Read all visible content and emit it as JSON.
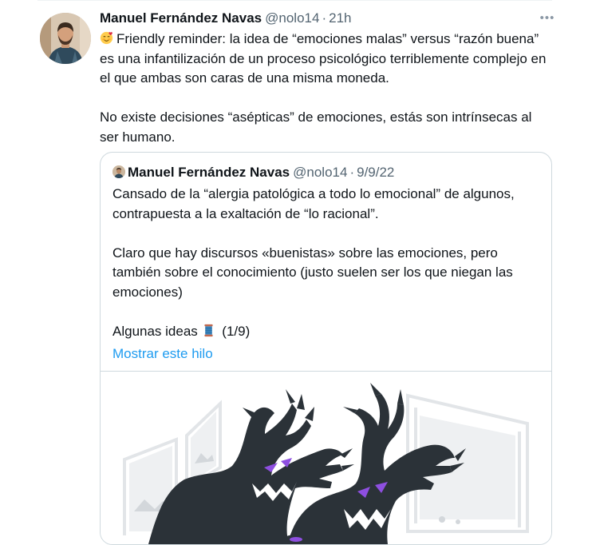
{
  "tweet": {
    "author_name": "Manuel Fernández Navas",
    "handle": "@nolo14",
    "separator": "·",
    "time": "21h",
    "emoji": "smiling-face-with-hearts",
    "paragraphs": [
      "Friendly reminder: la idea de “emociones malas” versus “razón buena” es una infantilización de un proceso psicológico terriblemente complejo en el que ambas son caras de una misma moneda.",
      "No existe decisiones “asépticas” de emociones, estás son intrínsecas al ser humano."
    ],
    "more_icon": "more-horizontal-icon"
  },
  "quoted_tweet": {
    "author_name": "Manuel Fernández Navas",
    "handle": "@nolo14",
    "separator": "·",
    "date": "9/9/22",
    "paragraphs": [
      "Cansado de la “alergia patológica a todo lo emocional” de algunos, contrapuesta a la exaltación de “lo racional”.",
      "Claro que hay discursos «buenistas» sobre las emociones, pero también sobre el conocimiento (justo suelen ser los que niegan las emociones)",
      "Algunas ideas"
    ],
    "thread_emoji": "spool-of-thread",
    "thread_count": "(1/9)",
    "show_thread_link": "Mostrar este hilo",
    "media": "illustration of shadow monsters in a room with picture frames"
  },
  "colors": {
    "text": "#0f1419",
    "secondary": "#536471",
    "link": "#1d9bf0",
    "border": "#cfd9de",
    "monster": "#2b3238",
    "monster_eyes": "#8e4fe0"
  }
}
